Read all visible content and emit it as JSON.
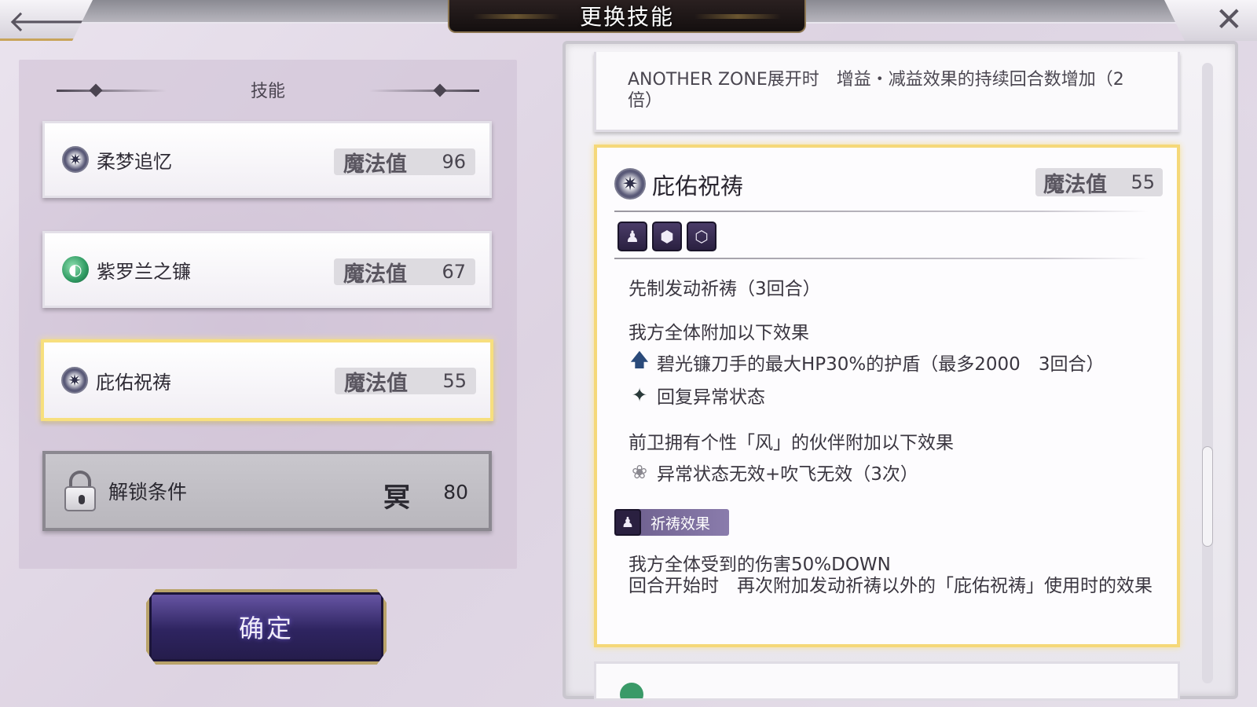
{
  "header": {
    "title": "更换技能",
    "back_icon": "arrow-left-icon",
    "close_icon": "close-icon"
  },
  "left_panel": {
    "header": "技能",
    "skills": [
      {
        "name": "柔梦追忆",
        "mp_label": "魔法值",
        "mp": "96",
        "icon": "star-burst-icon",
        "selected": false
      },
      {
        "name": "紫罗兰之镰",
        "mp_label": "魔法值",
        "mp": "67",
        "icon": "green-orb-icon",
        "selected": false
      },
      {
        "name": "庇佑祝祷",
        "mp_label": "魔法值",
        "mp": "55",
        "icon": "star-burst-icon",
        "selected": true
      }
    ],
    "locked": {
      "label": "解锁条件",
      "rank_glyph": "冥",
      "rank_value": "80",
      "icon": "lock-icon"
    },
    "confirm_label": "确定"
  },
  "right_panel": {
    "prev_card_text": "ANOTHER ZONE展开时　增益・减益效果的持续回合数增加（2倍）",
    "detail": {
      "name": "庇佑祝祷",
      "mp_label": "魔法值",
      "mp": "55",
      "tags": [
        "prayer-icon",
        "hex-shield-icon",
        "hex-core-icon"
      ],
      "line1": "先制发动祈祷（3回合）",
      "line2": "我方全体附加以下效果",
      "bullet1": "碧光镰刀手的最大HP30%的护盾（最多2000　3回合）",
      "bullet2": "回复异常状态",
      "line3": "前卫拥有个性「风」的伙伴附加以下效果",
      "bullet3": "异常状态无效+吹飞无效（3次）",
      "prayer_tag": "祈祷效果",
      "prayer_desc_1": "我方全体受到的伤害50%DOWN",
      "prayer_desc_2": "回合开始时　再次附加发动祈祷以外的「庇佑祝祷」使用时的效果"
    }
  },
  "colors": {
    "selected_border": "#f5d879",
    "confirm_bg": "#2e2460",
    "prayer_tag": "#7a6c9c"
  }
}
